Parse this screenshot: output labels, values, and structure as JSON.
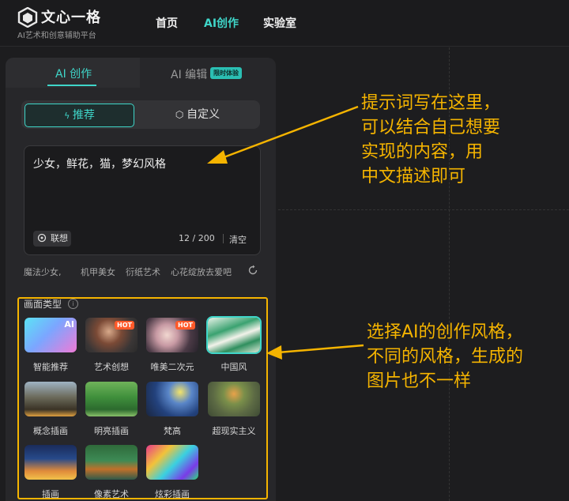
{
  "header": {
    "brand": "文心一格",
    "subtitle": "AI艺术和创意辅助平台",
    "nav": [
      "首页",
      "AI创作",
      "实验室"
    ]
  },
  "panel": {
    "tabs": {
      "create": "AI 创作",
      "edit": "AI 编辑",
      "edit_badge": "限时体验"
    },
    "segment": {
      "recommend": "推荐",
      "custom": "自定义"
    },
    "prompt": {
      "value": "少女，鲜花，猫，梦幻风格",
      "associate": "联想",
      "counter": "12 / 200",
      "clear": "清空"
    },
    "suggestions": [
      "魔法少女,",
      "机甲美女",
      "衍纸艺术",
      "心花绽放去爱吧"
    ],
    "style_section": {
      "label": "画面类型",
      "info_icon": "i",
      "styles": [
        {
          "label": "智能推荐",
          "tag": "AI"
        },
        {
          "label": "艺术创想",
          "tag": "HOT"
        },
        {
          "label": "唯美二次元",
          "tag": "HOT"
        },
        {
          "label": "中国风",
          "tag": ""
        },
        {
          "label": "概念插画",
          "tag": ""
        },
        {
          "label": "明亮插画",
          "tag": ""
        },
        {
          "label": "梵高",
          "tag": ""
        },
        {
          "label": "超现实主义",
          "tag": ""
        },
        {
          "label": "插画",
          "tag": ""
        },
        {
          "label": "像素艺术",
          "tag": ""
        },
        {
          "label": "炫彩插画",
          "tag": ""
        }
      ]
    }
  },
  "annotations": {
    "prompt_note": [
      "提示词写在这里，",
      "可以结合自己想要",
      "实现的内容，用",
      "中文描述即可"
    ],
    "style_note": [
      "选择AI的创作风格，",
      "不同的风格，生成的",
      "图片也不一样"
    ]
  },
  "colors": {
    "accent": "#3fd6c9",
    "annotation": "#f5b400",
    "hot": "#ff5a2a"
  }
}
